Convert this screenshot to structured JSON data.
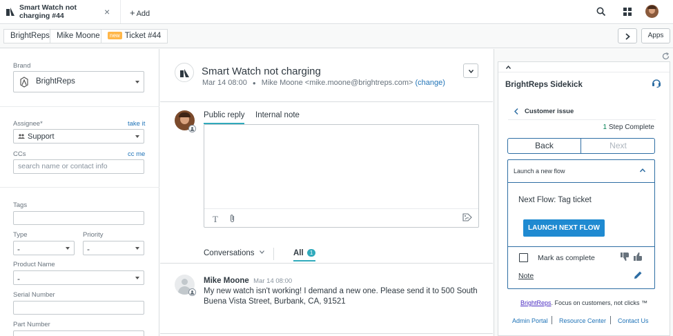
{
  "topbar": {
    "tab_title": "Smart Watch not charging #44",
    "add_label": "Add"
  },
  "breadcrumbs": {
    "brand": "BrightReps",
    "requester": "Mike Moone",
    "new_badge": "new",
    "ticket": "Ticket #44"
  },
  "apps_label": "Apps",
  "left": {
    "brand_label": "Brand",
    "brand_value": "BrightReps",
    "assignee_label": "Assignee*",
    "take_it": "take it",
    "assignee_value": "Support",
    "ccs_label": "CCs",
    "cc_me": "cc me",
    "cc_placeholder": "search name or contact info",
    "tags_label": "Tags",
    "type_label": "Type",
    "type_value": "-",
    "priority_label": "Priority",
    "priority_value": "-",
    "product_label": "Product Name",
    "product_value": "-",
    "serial_label": "Serial Number",
    "part_label": "Part Number"
  },
  "ticket": {
    "subject": "Smart Watch not charging",
    "date": "Mar 14 08:00",
    "requester": "Mike Moone <mike.moone@brightreps.com>",
    "change": "(change)"
  },
  "composer": {
    "tab_public": "Public reply",
    "tab_internal": "Internal note"
  },
  "conversations": {
    "filter_label": "Conversations",
    "all_label": "All",
    "all_count": "1"
  },
  "message": {
    "author": "Mike Moone",
    "time": "Mar 14 08:00",
    "body": "My new watch isn't working! I demand a new one. Please send it to 500 South Buena Vista Street, Burbank, CA, 91521"
  },
  "sidekick": {
    "title": "BrightReps Sidekick",
    "section": "Customer issue",
    "step_count": "1",
    "step_text": "Step Complete",
    "back": "Back",
    "next": "Next",
    "launch_header": "Launch a new flow",
    "next_flow": "Next Flow: Tag ticket",
    "launch_button": "LAUNCH NEXT FLOW",
    "mark_complete": "Mark as complete",
    "note": "Note",
    "footer_brand": "BrightReps",
    "footer_tagline": ". Focus on customers, not clicks ™",
    "links": [
      "Admin Portal",
      "Resource Center",
      "Contact Us"
    ]
  },
  "colors": {
    "accent": "#1f73b7",
    "sidekick_blue": "#2d6da3",
    "button_blue": "#1f8ad1",
    "new_badge": "#ffb648",
    "count_badge": "#30aabc"
  }
}
